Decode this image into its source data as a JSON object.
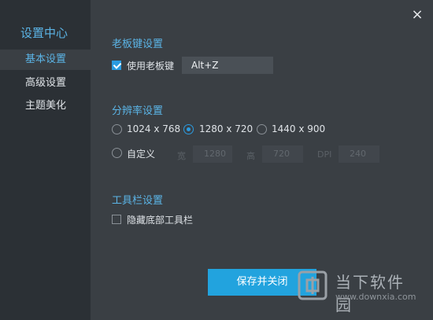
{
  "sidebar": {
    "title": "设置中心",
    "items": [
      {
        "label": "基本设置",
        "active": true
      },
      {
        "label": "高级设置",
        "active": false
      },
      {
        "label": "主题美化",
        "active": false
      }
    ]
  },
  "close_icon": "×",
  "boss_key": {
    "section_title": "老板键设置",
    "checkbox_label": "使用老板键",
    "checked": true,
    "value": "Alt+Z"
  },
  "resolution": {
    "section_title": "分辨率设置",
    "options": [
      "1024 x 768",
      "1280 x 720",
      "1440 x 900"
    ],
    "selected": "1280 x 720",
    "custom_label": "自定义",
    "width_label": "宽",
    "width_value": "1280",
    "height_label": "高",
    "height_value": "720",
    "dpi_label": "DPI",
    "dpi_value": "240"
  },
  "toolbar": {
    "section_title": "工具栏设置",
    "checkbox_label": "隐藏底部工具栏",
    "checked": false
  },
  "save_label": "保存并关闭",
  "watermark": {
    "name": "当下软件园",
    "url": "www.downxia.com"
  },
  "colors": {
    "accent": "#2b9be0",
    "sidebar_bg": "#2b3035",
    "content_bg": "#3a3f44",
    "title": "#5bb4e6"
  }
}
